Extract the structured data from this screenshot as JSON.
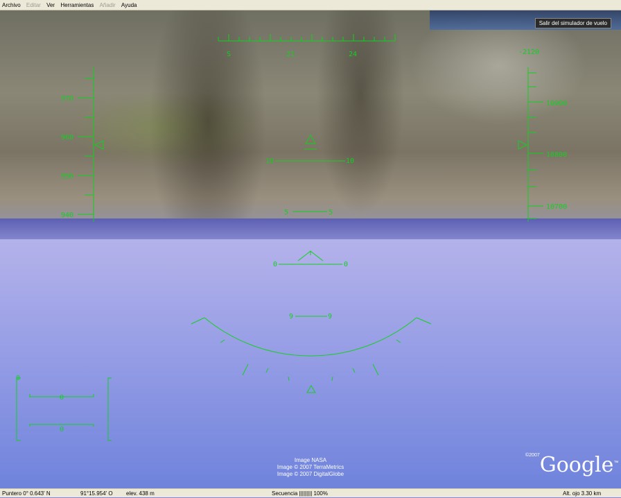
{
  "menu": {
    "items": [
      {
        "label": "Archivo",
        "enabled": true
      },
      {
        "label": "Editar",
        "enabled": false
      },
      {
        "label": "Ver",
        "enabled": true
      },
      {
        "label": "Herramientas",
        "enabled": true
      },
      {
        "label": "Añadir",
        "enabled": false
      },
      {
        "label": "Ayuda",
        "enabled": true
      }
    ]
  },
  "exit_button": "Salir del simulador de vuelo",
  "hud": {
    "heading_labels": [
      "S",
      "21",
      "24"
    ],
    "vertical_speed": "-2120",
    "speed_labels": [
      "970",
      "960",
      "950",
      "940"
    ],
    "altitude_labels": [
      "10900",
      "10800",
      "10700"
    ],
    "pitch_labels": [
      "10",
      "10",
      "5",
      "5",
      "0",
      "0"
    ],
    "roll_labels": [
      "9",
      "9"
    ],
    "gauge_labels": [
      "0",
      "0",
      "0"
    ]
  },
  "credits": [
    "Image NASA",
    "Image © 2007 TerraMetrics",
    "Image © 2007 DigitalGlobe"
  ],
  "logo": {
    "year": "©2007",
    "text": "Google",
    "tm": "™"
  },
  "status": {
    "pointer": "Puntero  0° 0.643' N",
    "lon": "91°15.954' O",
    "elev": "elev.  438 m",
    "stream": "Secuencia ||||||||| 100%",
    "eye": "Alt. ojo    3.30 km"
  },
  "colors": {
    "hud": "#12d020"
  }
}
